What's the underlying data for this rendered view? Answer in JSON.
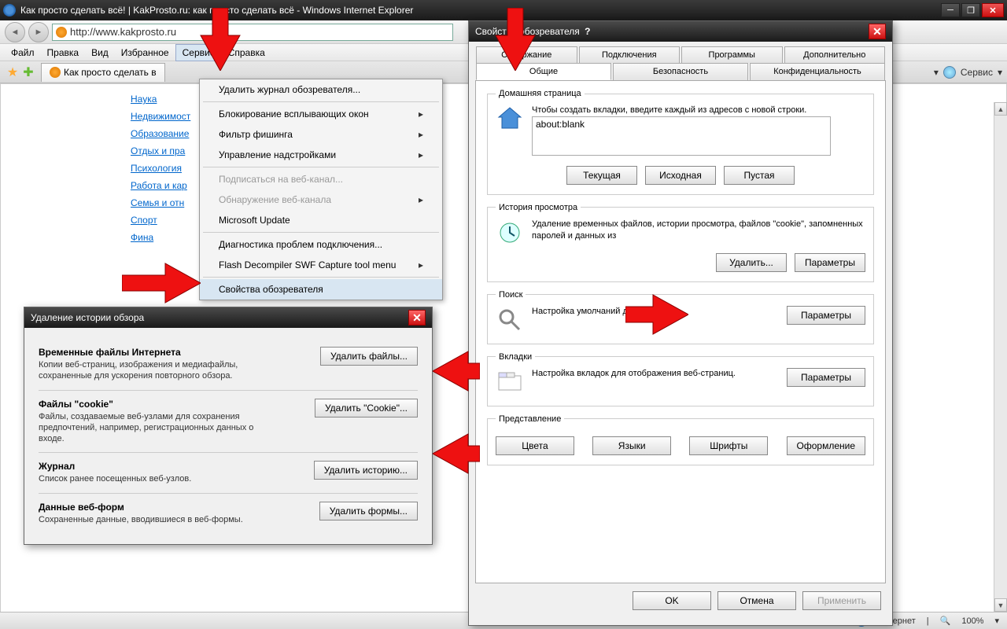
{
  "window": {
    "title": "Как просто сделать всё! | KakProsto.ru: как просто сделать всё - Windows Internet Explorer",
    "url": "http://www.kakprosto.ru"
  },
  "menubar": [
    "Файл",
    "Правка",
    "Вид",
    "Избранное",
    "Сервис",
    "Справка"
  ],
  "tab_label": "Как просто сделать в",
  "toolbar_service": "Сервис",
  "sidebar_links": [
    "Наука",
    "Недвижимост",
    "Образование",
    "Отдых и пра",
    "Психология",
    "Работа и кар",
    "Семья и отн",
    "Спорт",
    "Фина"
  ],
  "dropdown": {
    "delete_history": "Удалить журнал обозревателя...",
    "popup_block": "Блокирование всплывающих окон",
    "phishing": "Фильтр фишинга",
    "addons": "Управление надстройками",
    "subscribe": "Подписаться на веб-канал...",
    "detect_feed": "Обнаружение веб-канала",
    "ms_update": "Microsoft Update",
    "diag": "Диагностика проблем подключения...",
    "flash": "Flash Decompiler SWF Capture tool menu",
    "internet_options": "Свойства обозревателя"
  },
  "delete_dialog": {
    "title": "Удаление истории обзора",
    "sections": [
      {
        "h": "Временные файлы Интернета",
        "p": "Копии веб-страниц, изображения и медиафайлы, сохраненные для ускорения повторного обзора.",
        "btn": "Удалить файлы..."
      },
      {
        "h": "Файлы \"cookie\"",
        "p": "Файлы, создаваемые веб-узлами для сохранения предпочтений, например, регистрационных данных о входе.",
        "btn": "Удалить \"Cookie\"..."
      },
      {
        "h": "Журнал",
        "p": "Список ранее посещенных веб-узлов.",
        "btn": "Удалить историю..."
      },
      {
        "h": "Данные веб-форм",
        "p": "Сохраненные данные, вводившиеся в веб-формы.",
        "btn": "Удалить формы..."
      }
    ]
  },
  "options_dialog": {
    "title": "Свойства обозревателя",
    "tabs_row1": [
      "Содержание",
      "Подключения",
      "Программы",
      "Дополнительно"
    ],
    "tabs_row2": [
      "Общие",
      "Безопасность",
      "Конфиденциальность"
    ],
    "active_tab": "Общие",
    "homepage": {
      "legend": "Домашняя страница",
      "text": "Чтобы создать вкладки, введите каждый из адресов с новой строки.",
      "value": "about:blank",
      "btns": [
        "Текущая",
        "Исходная",
        "Пустая"
      ]
    },
    "history": {
      "legend": "История просмотра",
      "text": "Удаление временных файлов, истории просмотра, файлов \"cookie\", запомненных паролей и данных из",
      "btns": [
        "Удалить...",
        "Параметры"
      ]
    },
    "search": {
      "legend": "Поиск",
      "text": "Настройка умолчаний для поиска.",
      "btn": "Параметры"
    },
    "tabs_section": {
      "legend": "Вкладки",
      "text": "Настройка вкладок для отображения веб-страниц.",
      "btn": "Параметры"
    },
    "appearance": {
      "legend": "Представление",
      "btns": [
        "Цвета",
        "Языки",
        "Шрифты",
        "Оформление"
      ]
    },
    "footer": [
      "OK",
      "Отмена",
      "Применить"
    ]
  },
  "statusbar": {
    "zone": "Интернет",
    "zoom": "100%"
  }
}
